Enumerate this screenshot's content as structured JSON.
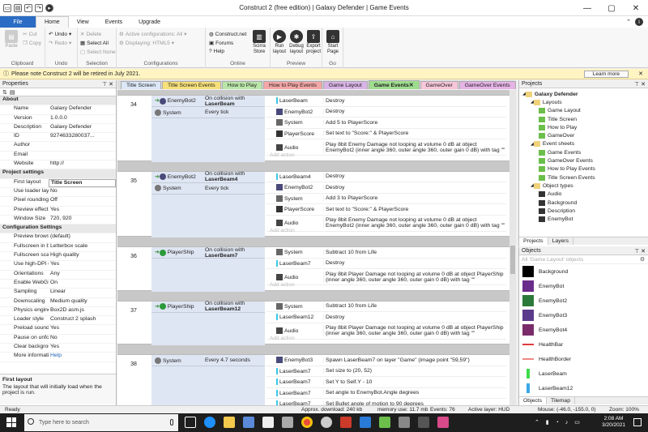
{
  "window": {
    "title": "Construct 2  (free edition) | Galaxy Defender | Game Events"
  },
  "ribbon_tabs": [
    "File",
    "Home",
    "View",
    "Events",
    "Upgrade"
  ],
  "ribbon": {
    "clipboard": {
      "label": "Clipboard",
      "paste": "Paste",
      "cut": "Cut",
      "copy": "Copy"
    },
    "undo": {
      "label": "Undo",
      "undo": "Undo",
      "redo": "Redo"
    },
    "selection": {
      "label": "Selection",
      "delete": "Delete",
      "select_all": "Select All",
      "select_none": "Select None"
    },
    "configs": {
      "label": "Configurations",
      "active": "Active configurations: All",
      "displaying": "Displaying: HTML5"
    },
    "online": {
      "label": "Online",
      "site": "Construct.net",
      "forums": "Forums",
      "help": "Help"
    },
    "preview": {
      "label": "Preview",
      "scirra": "Scirra Store",
      "run": "Run layout",
      "debug": "Debug layout",
      "export": "Export project"
    },
    "go": {
      "label": "Go",
      "start": "Start Page"
    }
  },
  "notice": {
    "text": "Please note Construct 2 will be retired in July 2021.",
    "button": "Learn more"
  },
  "properties": {
    "header": "Properties",
    "rows": [
      {
        "sec": "About"
      },
      {
        "k": "Name",
        "v": "Galaxy Defender"
      },
      {
        "k": "Version",
        "v": "1.0.0.0"
      },
      {
        "k": "Description",
        "v": "Galaxy Defender"
      },
      {
        "k": "ID",
        "v": "9274633280037..."
      },
      {
        "k": "Author",
        "v": ""
      },
      {
        "k": "Email",
        "v": ""
      },
      {
        "k": "Website",
        "v": "http://"
      },
      {
        "sec": "Project settings"
      },
      {
        "k": "First layout",
        "v": "Title Screen"
      },
      {
        "k": "Use loader layout",
        "v": "No"
      },
      {
        "k": "Pixel rounding",
        "v": "Off"
      },
      {
        "k": "Preview effects",
        "v": "Yes"
      },
      {
        "k": "Window Size",
        "v": "720, 920"
      },
      {
        "sec": "Configuration Settings"
      },
      {
        "k": "Preview browser",
        "v": "(default)"
      },
      {
        "k": "Fullscreen in bro...",
        "v": "Letterbox scale"
      },
      {
        "k": "Fullscreen scaling",
        "v": "High quality"
      },
      {
        "k": "Use high-DPI dis...",
        "v": "Yes"
      },
      {
        "k": "Orientations",
        "v": "Any"
      },
      {
        "k": "Enable WebGL",
        "v": "On"
      },
      {
        "k": "Sampling",
        "v": "Linear"
      },
      {
        "k": "Downscaling",
        "v": "Medium quality"
      },
      {
        "k": "Physics engine",
        "v": "Box2D asm.js"
      },
      {
        "k": "Loader style",
        "v": "Construct 2 splash"
      },
      {
        "k": "Preload sounds",
        "v": "Yes"
      },
      {
        "k": "Pause on unfocus",
        "v": "No"
      },
      {
        "k": "Clear background",
        "v": "Yes"
      },
      {
        "k": "More information",
        "v": "Help"
      }
    ],
    "desc_title": "First layout",
    "desc_text": "The layout that will initially load when the project is run."
  },
  "event_tabs": [
    {
      "label": "Title Screen",
      "color": "#dbe7f7"
    },
    {
      "label": "Title Screen Events",
      "color": "#f7e07a"
    },
    {
      "label": "How to Play",
      "color": "#b9e6a8"
    },
    {
      "label": "How to Play Events",
      "color": "#f4a6a6"
    },
    {
      "label": "Game Layout",
      "color": "#d9b3e6"
    },
    {
      "label": "Game Events",
      "color": "#9fdc8e"
    },
    {
      "label": "GameOver",
      "color": "#f7c6d9"
    },
    {
      "label": "GameOver Events",
      "color": "#e6b3e6"
    }
  ],
  "events": [
    {
      "num": "34",
      "conds": [
        {
          "obj": "EnemyBot2",
          "txt": "On collision with",
          "bold": "LaserBeam"
        },
        {
          "obj": "System",
          "txt": "Every tick",
          "bold": ""
        }
      ],
      "acts": [
        {
          "obj": "LaserBeam",
          "txt": "Destroy"
        },
        {
          "obj": "EnemyBot2",
          "txt": "Destroy"
        },
        {
          "obj": "System",
          "txt": "Add 5 to PlayerScore"
        },
        {
          "obj": "PlayerScore",
          "txt": "Set text to \"Score:\" & PlayerScore"
        },
        {
          "obj": "Audio",
          "txt": "Play 8bit Enemy Damage not looping at volume 0 dB at object EnemyBot2 (inner angle 360, outer angle 360, outer gain 0 dB) with tag \"\""
        }
      ]
    },
    {
      "num": "35",
      "conds": [
        {
          "obj": "EnemyBot2",
          "txt": "On collision with",
          "bold": "LaserBeam4"
        },
        {
          "obj": "System",
          "txt": "Every tick",
          "bold": ""
        }
      ],
      "acts": [
        {
          "obj": "LaserBeam4",
          "txt": "Destroy"
        },
        {
          "obj": "EnemyBot2",
          "txt": "Destroy"
        },
        {
          "obj": "System",
          "txt": "Add 3 to PlayerScore"
        },
        {
          "obj": "PlayerScore",
          "txt": "Set text to \"Score:\" & PlayerScore"
        },
        {
          "obj": "Audio",
          "txt": "Play 8bit Enemy Damage not looping at volume 0 dB at object EnemyBot2 (inner angle 360, outer angle 360, outer gain 0 dB) with tag \"\""
        }
      ]
    },
    {
      "num": "36",
      "conds": [
        {
          "obj": "PlayerShip",
          "txt": "On collision with",
          "bold": "LaserBeam7"
        }
      ],
      "acts": [
        {
          "obj": "System",
          "txt": "Subtract 10 from Life"
        },
        {
          "obj": "LaserBeam7",
          "txt": "Destroy"
        },
        {
          "obj": "Audio",
          "txt": "Play 8bit Player Damage not looping at volume 0 dB at object PlayerShip (inner angle 360, outer angle 360, outer gain 0 dB) with tag \"\""
        }
      ]
    },
    {
      "num": "37",
      "conds": [
        {
          "obj": "PlayerShip",
          "txt": "On collision with",
          "bold": "LaserBeam12"
        }
      ],
      "acts": [
        {
          "obj": "System",
          "txt": "Subtract 10 from Life"
        },
        {
          "obj": "LaserBeam12",
          "txt": "Destroy"
        },
        {
          "obj": "Audio",
          "txt": "Play 8bit Player Damage not looping at volume 0 dB at object PlayerShip (inner angle 360, outer angle 360, outer gain 0 dB) with tag \"\""
        }
      ]
    },
    {
      "num": "38",
      "conds": [
        {
          "obj": "System",
          "txt": "Every 4.7 seconds",
          "bold": ""
        }
      ],
      "acts": [
        {
          "obj": "EnemyBot3",
          "txt": "Spawn LaserBeam7 on layer \"Game\" (image point \"59,59\")"
        },
        {
          "obj": "LaserBeam7",
          "txt": "Set size to (20, 52)"
        },
        {
          "obj": "LaserBeam7",
          "txt": "Set Y to Self.Y - 10"
        },
        {
          "obj": "LaserBeam7",
          "txt": "Set angle to EnemyBot.Angle degrees"
        },
        {
          "obj": "LaserBeam7",
          "txt": "Set Bullet angle of motion to 90 degrees"
        }
      ]
    }
  ],
  "add_action": "Add action",
  "projects": {
    "header": "Projects",
    "tree": [
      {
        "lvl": 0,
        "t": "Galaxy Defender",
        "bold": true
      },
      {
        "lvl": 1,
        "t": "Layouts",
        "folder": true
      },
      {
        "lvl": 2,
        "t": "Game Layout"
      },
      {
        "lvl": 2,
        "t": "Title Screen"
      },
      {
        "lvl": 2,
        "t": "How to Play"
      },
      {
        "lvl": 2,
        "t": "GameOver"
      },
      {
        "lvl": 1,
        "t": "Event sheets",
        "folder": true
      },
      {
        "lvl": 2,
        "t": "Game Events"
      },
      {
        "lvl": 2,
        "t": "GameOver Events"
      },
      {
        "lvl": 2,
        "t": "How to Play Events"
      },
      {
        "lvl": 2,
        "t": "Title Screen Events"
      },
      {
        "lvl": 1,
        "t": "Object types",
        "folder": true
      },
      {
        "lvl": 2,
        "t": "Audio"
      },
      {
        "lvl": 2,
        "t": "Background"
      },
      {
        "lvl": 2,
        "t": "Description"
      },
      {
        "lvl": 2,
        "t": "EnemyBot"
      }
    ],
    "tabs": [
      "Projects",
      "Layers"
    ]
  },
  "objects": {
    "header": "Objects",
    "filter": "All 'Game Layout' objects",
    "items": [
      {
        "name": "Background",
        "color": "#000000"
      },
      {
        "name": "EnemyBot",
        "color": "#6a2c8a"
      },
      {
        "name": "EnemyBot2",
        "color": "#2c7a3a"
      },
      {
        "name": "EnemyBot3",
        "color": "#5a3a8a"
      },
      {
        "name": "EnemyBot4",
        "color": "#7a2c6a"
      },
      {
        "name": "HealthBar",
        "color": "#e23b3b"
      },
      {
        "name": "HealthBorder",
        "color": "#e88"
      },
      {
        "name": "LaserBeam",
        "color": "#3ddc4a"
      },
      {
        "name": "LaserBeam12",
        "color": "#3aa8e8"
      }
    ],
    "tabs": [
      "Objects",
      "Tilemap"
    ]
  },
  "status": {
    "ready": "Ready",
    "download": "Approx. download: 240 kb",
    "memory": "memory use: 11.7 mb",
    "events": "Events: 76",
    "layer": "Active layer: HUD",
    "mouse": "Mouse: (-46.0, -155.0, 0)",
    "zoom": "Zoom: 100%"
  },
  "taskbar": {
    "search": "Type here to search",
    "time": "2:08 AM",
    "date": "3/20/2021"
  }
}
